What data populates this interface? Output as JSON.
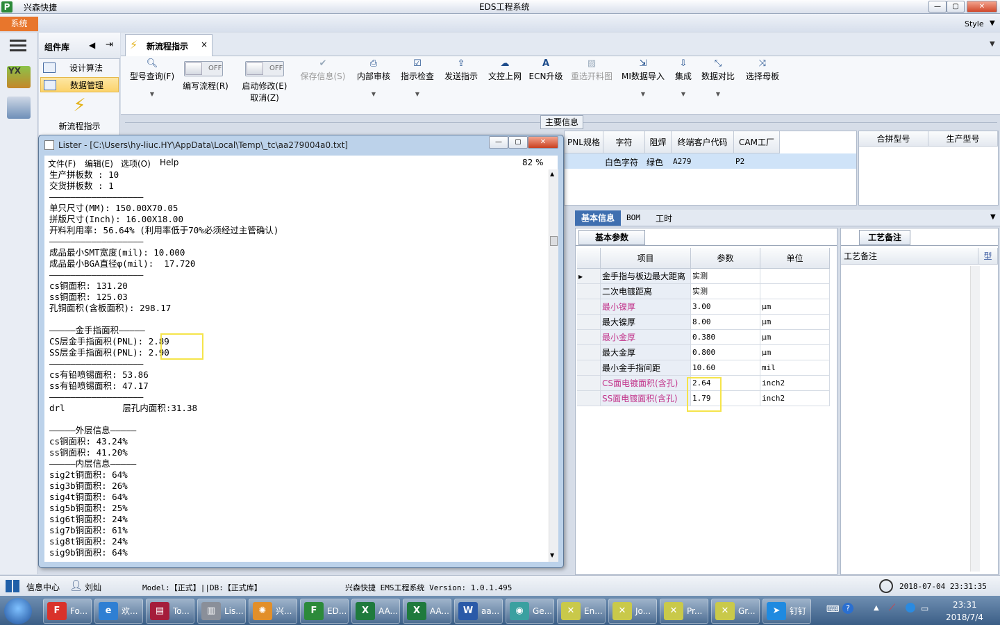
{
  "titlebar": {
    "app": "兴森快捷",
    "title": "EDS工程系统",
    "min": "—",
    "max": "▢",
    "close": "✕"
  },
  "menu": {
    "system": "系统",
    "style": "Style"
  },
  "rail": {
    "yx_label": "YX"
  },
  "components": {
    "title": "组件库",
    "items": [
      "设计算法",
      "数据管理"
    ],
    "flow_label": "新流程指示"
  },
  "tab": {
    "label": "新流程指示",
    "close": "×"
  },
  "ribbon": {
    "buttons": [
      {
        "label": "型号查询(F)",
        "icon": "search-icon"
      },
      {
        "label": "编写流程(R)",
        "toggle": "OFF"
      },
      {
        "label": "启动修改(E)",
        "sub": "取消(Z)",
        "toggle": "OFF"
      },
      {
        "label": "保存信息(S)"
      },
      {
        "label": "内部审核"
      },
      {
        "label": "指示检查"
      },
      {
        "label": "发送指示"
      },
      {
        "label": "文控上网"
      },
      {
        "label": "ECN升级"
      },
      {
        "label": "重选开料图"
      },
      {
        "label": "MI数据导入"
      },
      {
        "label": "集成"
      },
      {
        "label": "数据对比"
      },
      {
        "label": "选择母板"
      }
    ]
  },
  "main_info": {
    "label": "主要信息"
  },
  "top_grid": {
    "headers": [
      "PNL规格",
      "字符",
      "阻焊",
      "终端客户代码",
      "CAM工厂"
    ],
    "row": [
      "",
      "白色字符",
      "绿色",
      "A279",
      "P2"
    ]
  },
  "right_grid": {
    "headers": [
      "合拼型号",
      "生产型号"
    ]
  },
  "lower_tabs": [
    "基本信息",
    "BOM",
    "工时"
  ],
  "basic": {
    "subtab": "基本参数",
    "headers": [
      "项目",
      "参数",
      "单位"
    ],
    "rows": [
      {
        "item": "金手指与板边最大距离",
        "value": "实测",
        "unit": "",
        "pink": false
      },
      {
        "item": "二次电镀距离",
        "value": "实测",
        "unit": "",
        "pink": false
      },
      {
        "item": "最小镍厚",
        "value": "3.00",
        "unit": "μm",
        "pink": true
      },
      {
        "item": "最大镍厚",
        "value": "8.00",
        "unit": "μm",
        "pink": false
      },
      {
        "item": "最小金厚",
        "value": "0.380",
        "unit": "μm",
        "pink": true
      },
      {
        "item": "最大金厚",
        "value": "0.800",
        "unit": "μm",
        "pink": false
      },
      {
        "item": "最小金手指间距",
        "value": "10.60",
        "unit": "mil",
        "pink": false
      },
      {
        "item": "CS面电镀面积(含孔)",
        "value": "2.64",
        "unit": "inch2",
        "pink": true
      },
      {
        "item": "SS面电镀面积(含孔)",
        "value": "1.79",
        "unit": "inch2",
        "pink": true
      }
    ]
  },
  "notes": {
    "tab": "工艺备注",
    "col": "工艺备注",
    "col2": "型"
  },
  "lister": {
    "title": "Lister - [C:\\Users\\hy-liuc.HY\\AppData\\Local\\Temp\\_tc\\aa279004a0.txt]",
    "menu": [
      "文件(F)",
      "编辑(E)",
      "选项(O)",
      "Help"
    ],
    "zoom": "82 %",
    "lines": [
      "生产拼板数 : 10",
      "交货拼板数 : 1",
      "——————————————————",
      "单只尺寸(MM): 150.00X70.05",
      "拼版尺寸(Inch): 16.00X18.00",
      "开料利用率: 56.64% (利用率低于70%必须经过主管确认)",
      "——————————————————",
      "成品最小SMT宽度(mil): 10.000",
      "成品最小BGA直径φ(mil):  17.720",
      "——————————————————",
      "cs铜面积: 131.20",
      "ss铜面积: 125.03",
      "孔铜面积(含板面积): 298.17",
      "",
      "—————金手指面积—————",
      "CS层金手指面积(PNL): 2.89",
      "SS层金手指面积(PNL): 2.90",
      "——————————————————",
      "cs有铅喷锡面积: 53.86",
      "ss有铅喷锡面积: 47.17",
      "——————————————————",
      "drl           层孔内面积:31.38",
      "",
      "—————外层信息—————",
      "cs铜面积: 43.24%",
      "ss铜面积: 41.20%",
      "—————内层信息—————",
      "sig2t铜面积: 64%",
      "sig3b铜面积: 26%",
      "sig4t铜面积: 64%",
      "sig5b铜面积: 25%",
      "sig6t铜面积: 24%",
      "sig7b铜面积: 61%",
      "sig8t铜面积: 24%",
      "sig9b铜面积: 64%"
    ]
  },
  "status": {
    "info": "信息中心",
    "user": "刘灿",
    "model": "Model:【正式】||DB:【正式库】",
    "version": "兴森快捷 EMS工程系统 Version: 1.0.1.495",
    "datetime": "2018-07-04 23:31:35"
  },
  "taskbar": {
    "items": [
      {
        "label": "Fo...",
        "color": "#d9322b",
        "glyph": "F"
      },
      {
        "label": "欢...",
        "color": "#2f7fd3",
        "glyph": "e"
      },
      {
        "label": "To...",
        "color": "#a51d3b",
        "glyph": "▤"
      },
      {
        "label": "Lis...",
        "color": "#8a8f99",
        "glyph": "▥"
      },
      {
        "label": "兴...",
        "color": "#e28f2a",
        "glyph": "✺"
      },
      {
        "label": "ED...",
        "color": "#2c8a3a",
        "glyph": "F"
      },
      {
        "label": "AA...",
        "color": "#1f7a3d",
        "glyph": "X"
      },
      {
        "label": "AA...",
        "color": "#1f7a3d",
        "glyph": "X"
      },
      {
        "label": "aa...",
        "color": "#2a5aa8",
        "glyph": "W"
      },
      {
        "label": "Ge...",
        "color": "#3aa0a0",
        "glyph": "◉"
      },
      {
        "label": "En...",
        "color": "#c9c94a",
        "glyph": "✕"
      },
      {
        "label": "Jo...",
        "color": "#c9c94a",
        "glyph": "✕"
      },
      {
        "label": "Pr...",
        "color": "#c9c94a",
        "glyph": "✕"
      },
      {
        "label": "Gr...",
        "color": "#c9c94a",
        "glyph": "✕"
      },
      {
        "label": "钉钉",
        "color": "#1f8ae0",
        "glyph": "➤"
      }
    ],
    "time": "23:31",
    "date": "2018/7/4"
  }
}
